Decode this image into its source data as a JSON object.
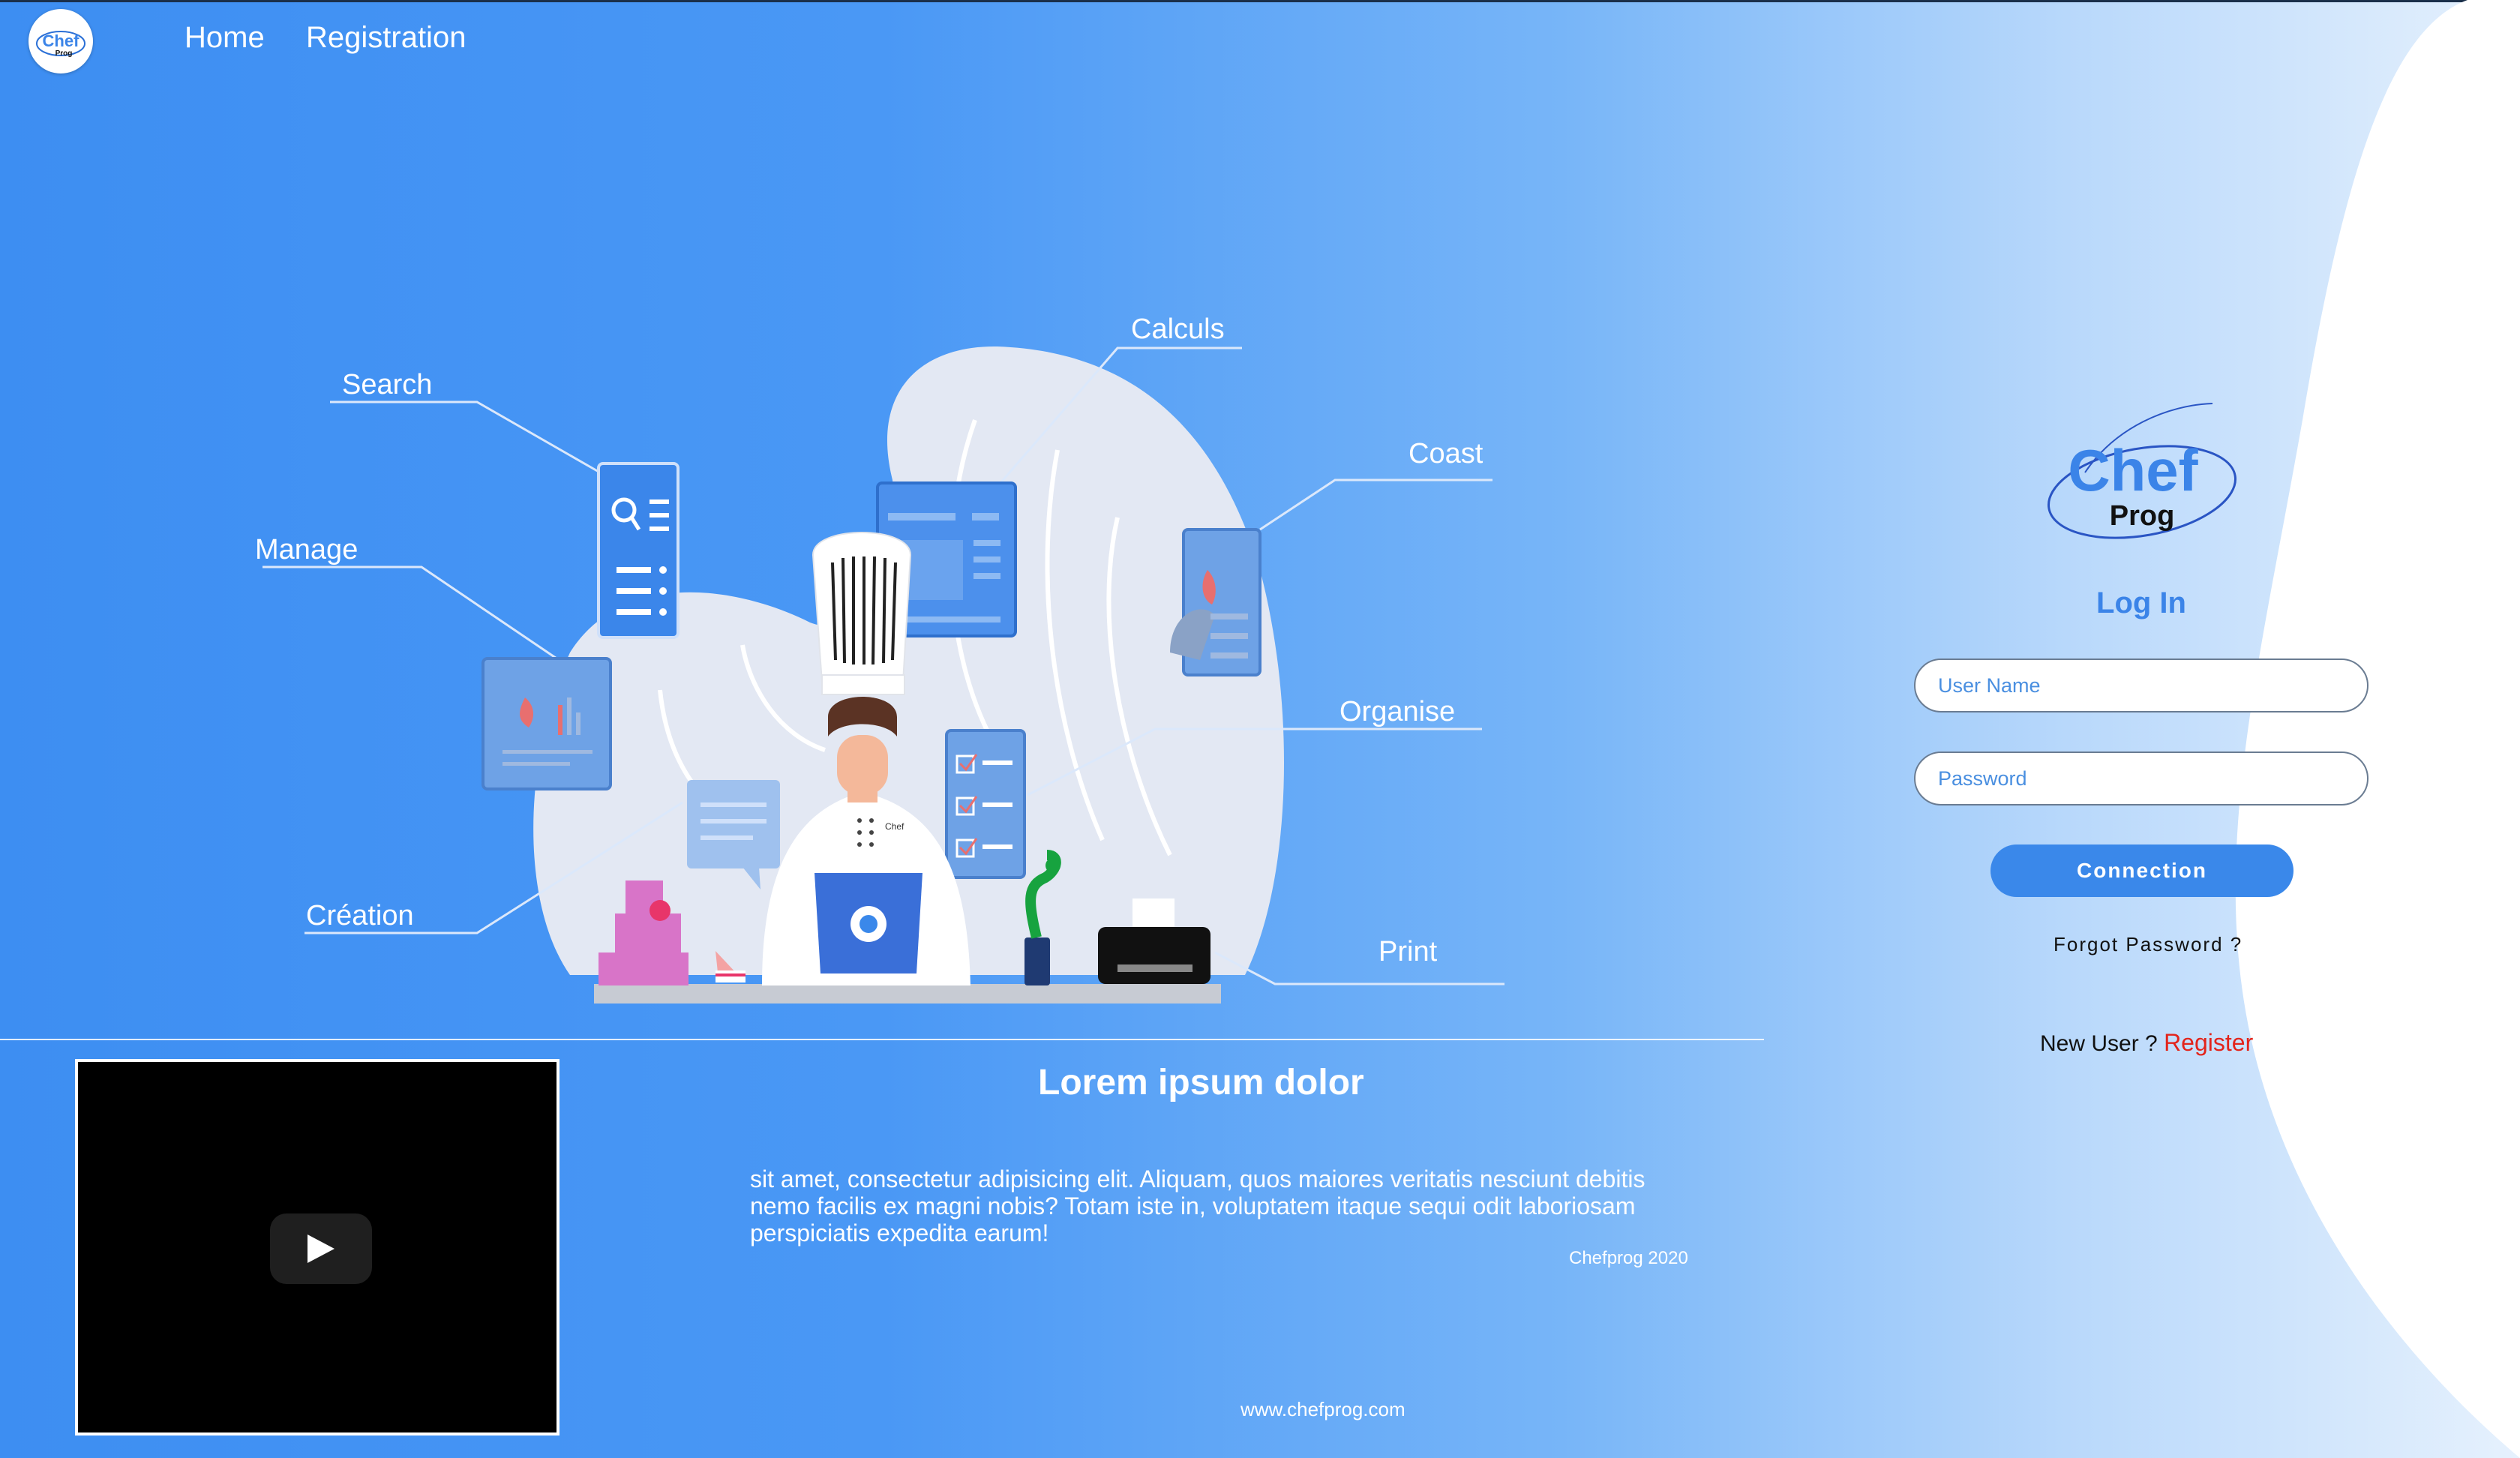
{
  "header": {
    "logo_text_top": "Chef",
    "logo_text_bottom": "Prog",
    "nav": [
      {
        "label": "Home"
      },
      {
        "label": "Registration"
      }
    ]
  },
  "illustration": {
    "labels": {
      "search": "Search",
      "manage": "Manage",
      "creation": "Création",
      "calculs": "Calculs",
      "coast": "Coast",
      "organise": "Organise",
      "print": "Print"
    },
    "chef_badge": "Chef"
  },
  "article": {
    "title": "Lorem ipsum dolor",
    "body": "sit amet, consectetur adipisicing elit. Aliquam, quos maiores veritatis nesciunt debitis nemo facilis ex magni nobis? Totam iste in, voluptatem itaque sequi odit laboriosam perspiciatis expedita earum!",
    "credit": "Chefprog 2020"
  },
  "footer": {
    "url": "www.chefprog.com"
  },
  "login": {
    "brand_top": "Chef",
    "brand_bottom": "Prog",
    "title": "Log In",
    "username_placeholder": "User Name",
    "password_placeholder": "Password",
    "connect_label": "Connection",
    "forgot_label": "Forgot Password ?",
    "new_user_prefix": "New User ?",
    "register_label": "Register"
  },
  "colors": {
    "accent": "#3a88ea",
    "register": "#e3241b",
    "background_left": "#3d8ef2",
    "background_right": "#e6f1fd"
  }
}
